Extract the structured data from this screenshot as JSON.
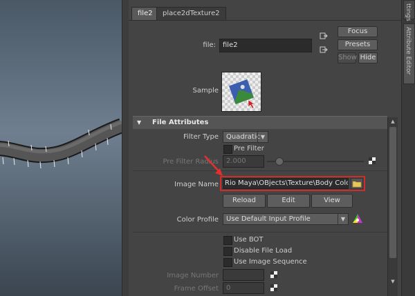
{
  "tabs": [
    "file2",
    "place2dTexture2"
  ],
  "right_tabs": {
    "top": "ttings",
    "attribute_editor": "Attribute Editor"
  },
  "file_row": {
    "label": "file:",
    "value": "file2"
  },
  "side_buttons": {
    "focus": "Focus",
    "presets": "Presets",
    "show": "Show",
    "hide": "Hide"
  },
  "sample": {
    "label": "Sample"
  },
  "section": {
    "title": "File Attributes",
    "toggle": "▼"
  },
  "filter_type": {
    "label": "Filter Type",
    "value": "Quadratic"
  },
  "pre_filter": {
    "label": "Pre Filter"
  },
  "pre_filter_radius": {
    "label": "Pre Filter Radius",
    "value": "2.000"
  },
  "image_name": {
    "label": "Image Name",
    "value": "Rio Maya\\OBjects\\Texture\\Body Color.PSD"
  },
  "image_buttons": {
    "reload": "Reload",
    "edit": "Edit",
    "view": "View"
  },
  "color_profile": {
    "label": "Color Profile",
    "value": "Use Default Input Profile"
  },
  "checkboxes": {
    "use_bot": "Use BOT",
    "disable_file_load": "Disable File Load",
    "use_image_sequence": "Use Image Sequence"
  },
  "image_number": {
    "label": "Image Number",
    "value": ""
  },
  "frame_offset": {
    "label": "Frame Offset",
    "value": "0"
  },
  "colors": {
    "highlight_box": "#d42a2a",
    "annotation_arrow": "#e03030"
  }
}
